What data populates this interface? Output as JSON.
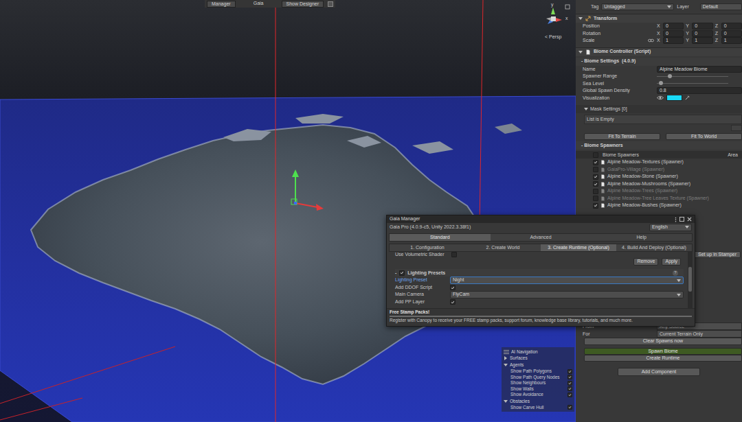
{
  "scene": {
    "toolbar": [
      {
        "label": "Manager",
        "kind": "button"
      },
      {
        "label": "Gaia",
        "kind": "label"
      },
      {
        "label": "Show Designer",
        "kind": "button"
      }
    ],
    "gizmo": {
      "y_label": "y",
      "x_label": "x",
      "projection": "< Persp"
    },
    "ai_navigation": {
      "title": "AI Navigation",
      "sections": [
        {
          "label": "Surfaces",
          "expanded": false,
          "items": []
        },
        {
          "label": "Agents",
          "expanded": true,
          "items": [
            {
              "label": "Show Path Polygons",
              "checked": true
            },
            {
              "label": "Show Path Query Nodes",
              "checked": true
            },
            {
              "label": "Show Neighbours",
              "checked": true
            },
            {
              "label": "Show Walls",
              "checked": true
            },
            {
              "label": "Show Avoidance",
              "checked": true
            }
          ]
        },
        {
          "label": "Obstacles",
          "expanded": true,
          "items": [
            {
              "label": "Show Carve Hull",
              "checked": true
            }
          ]
        }
      ]
    }
  },
  "inspector": {
    "tag": {
      "label": "Tag",
      "value": "Untagged"
    },
    "layer": {
      "label": "Layer",
      "value": "Default"
    },
    "transform": {
      "title": "Transform",
      "expanded": true,
      "rows": [
        {
          "label": "Position",
          "linked": false,
          "values": [
            {
              "axis": "X",
              "value": "0"
            },
            {
              "axis": "Y",
              "value": "0"
            },
            {
              "axis": "Z",
              "value": "0"
            }
          ]
        },
        {
          "label": "Rotation",
          "linked": false,
          "values": [
            {
              "axis": "X",
              "value": "0"
            },
            {
              "axis": "Y",
              "value": "0"
            },
            {
              "axis": "Z",
              "value": "0"
            }
          ]
        },
        {
          "label": "Scale",
          "linked": true,
          "values": [
            {
              "axis": "X",
              "value": "1"
            },
            {
              "axis": "Y",
              "value": "1"
            },
            {
              "axis": "Z",
              "value": "1"
            }
          ]
        }
      ]
    },
    "biome_controller": {
      "title": "Biome Controller (Script)",
      "expanded": true
    },
    "biome_settings": {
      "title": "- Biome Settings  (4.0.9)",
      "fields": [
        {
          "kind": "text",
          "label": "Name",
          "value": "Alpine Meadow Biome"
        },
        {
          "kind": "slider",
          "label": "Spawner Range",
          "level": 0.15
        },
        {
          "kind": "slider",
          "label": "Sea Level",
          "level": 0.05
        },
        {
          "kind": "text",
          "label": "Global Spawn Density",
          "value": "0.8"
        },
        {
          "kind": "color",
          "label": "Visualization",
          "visible": true,
          "color": "#19d9f5"
        }
      ]
    },
    "mask_settings": {
      "title": "Mask Settings [0]",
      "expanded": true,
      "empty_text": "List is Empty"
    },
    "fit_buttons": [
      "Fit To Terrain",
      "Fit To World"
    ],
    "spawners": {
      "title": "- Biome Spawners",
      "columns": [
        "Biome Spawners",
        "Area"
      ],
      "all_checked": false,
      "rows": [
        {
          "name": "Alpine Meadow-Textures (Spawner)",
          "checked": true,
          "disabled": false
        },
        {
          "name": "GaiaPro-Village (Spawner)",
          "checked": false,
          "disabled": true
        },
        {
          "name": "Alpine Meadow-Stone (Spawner)",
          "checked": true,
          "disabled": false
        },
        {
          "name": "Alpine Meadow-Mushrooms (Spawner)",
          "checked": true,
          "disabled": false
        },
        {
          "name": "Alpine Meadow-Trees (Spawner)",
          "checked": false,
          "disabled": true
        },
        {
          "name": "Alpine Meadow-Tree Leaves Texture (Spawner)",
          "checked": false,
          "disabled": true
        },
        {
          "name": "Alpine Meadow-Bushes (Spawner)",
          "checked": true,
          "disabled": false
        }
      ]
    },
    "stamper_button": "Set up in Stamper",
    "clear_spawns": {
      "rows": [
        {
          "label": "From",
          "value": "Any Source"
        },
        {
          "label": "For",
          "value": "Current Terrain Only"
        }
      ],
      "button": "Clear Spawns now"
    },
    "spawn_button": "Spawn Biome",
    "runtime_button": "Create Runtime",
    "add_component": "Add Component"
  },
  "gaia_manager": {
    "title": "Gaia Manager",
    "version": "Gaia Pro (4.0.9-c5, Unity 2022.3.38f1)",
    "language": "English",
    "tabs": [
      {
        "label": "Standard",
        "selected": true
      },
      {
        "label": "Advanced",
        "selected": false
      },
      {
        "label": "Help",
        "selected": false
      }
    ],
    "steps": [
      {
        "label": "1. Configuration",
        "selected": false
      },
      {
        "label": "2. Create World",
        "selected": false
      },
      {
        "label": "3. Create Runtime (Optional)",
        "selected": true
      },
      {
        "label": "4. Build And Deploy (Optional)",
        "selected": false
      }
    ],
    "partial_row": {
      "label": "Use Volumetric Shader",
      "checked": false
    },
    "actions": [
      "Remove",
      "Apply"
    ],
    "section": {
      "prefix": "-",
      "enabled": true,
      "title": "Lighting Presets",
      "help": "?"
    },
    "fields": [
      {
        "kind": "dropdown",
        "label": "Lighting Preset",
        "value": "Night",
        "focused": true
      },
      {
        "kind": "checkbox",
        "label": "Add DDOF Script",
        "checked": true,
        "focused": false
      },
      {
        "kind": "dropdown",
        "label": "Main Camera",
        "value": "FlyCam",
        "focused": false
      },
      {
        "kind": "checkbox",
        "label": "Add PP Layer",
        "checked": true,
        "focused": false
      }
    ],
    "footer": {
      "title": "Free Stamp Packs!",
      "text": "Register with Canopy to receive your FREE stamp packs, support forum, knowledge base library, tutorials, and much more."
    }
  }
}
